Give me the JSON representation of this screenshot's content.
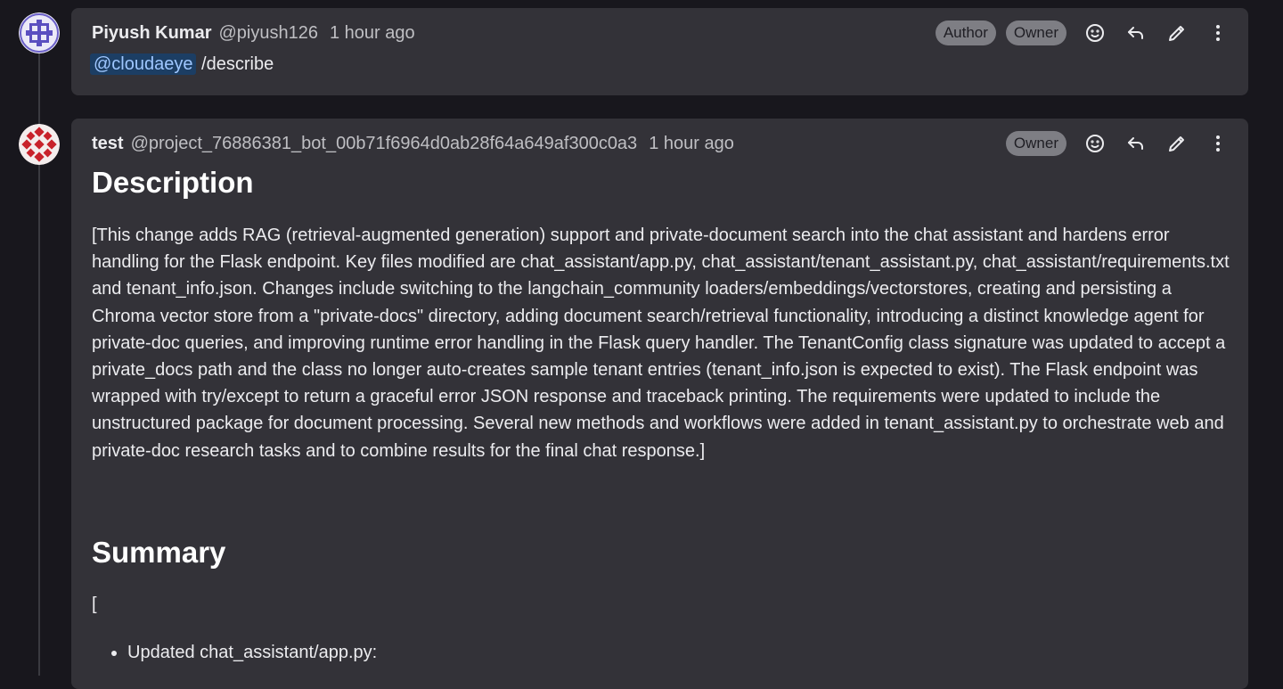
{
  "colors": {
    "background": "#18171d",
    "card": "#333238",
    "badge": "#7e7e84",
    "mention_bg": "#1c3e64",
    "mention_text": "#9fc7ff"
  },
  "notes": [
    {
      "author_name": "Piyush Kumar",
      "author_handle": "@piyush126",
      "time": "1 hour ago",
      "badges": [
        "Author",
        "Owner"
      ],
      "avatar_icon": "identicon-avatar",
      "mention": "@cloudaeye",
      "command": "/describe",
      "actions": [
        "add-reaction-icon",
        "reply-icon",
        "edit-icon",
        "more-actions-icon"
      ]
    },
    {
      "author_name": "test",
      "author_handle": "@project_76886381_bot_00b71f6964d0ab28f64a649af300c0a3",
      "time": "1 hour ago",
      "badges": [
        "Owner"
      ],
      "avatar_icon": "bot-avatar",
      "actions": [
        "add-reaction-icon",
        "reply-icon",
        "edit-icon",
        "more-actions-icon"
      ],
      "description_heading": "Description",
      "description_text": "[This change adds RAG (retrieval-augmented generation) support and private-document search into the chat assistant and hardens error handling for the Flask endpoint. Key files modified are chat_assistant/app.py, chat_assistant/tenant_assistant.py, chat_assistant/requirements.txt and tenant_info.json. Changes include switching to the langchain_community loaders/embeddings/vectorstores, creating and persisting a Chroma vector store from a \"private-docs\" directory, adding document search/retrieval functionality, introducing a distinct knowledge agent for private-doc queries, and improving runtime error handling in the Flask query handler. The TenantConfig class signature was updated to accept a private_docs path and the class no longer auto-creates sample tenant entries (tenant_info.json is expected to exist). The Flask endpoint was wrapped with try/except to return a graceful error JSON response and traceback printing. The requirements were updated to include the unstructured package for document processing. Several new methods and workflows were added in tenant_assistant.py to orchestrate web and private-doc research tasks and to combine results for the final chat response.]",
      "summary_heading": "Summary",
      "summary_open": "[",
      "summary_items": [
        "Updated chat_assistant/app.py:"
      ]
    }
  ]
}
